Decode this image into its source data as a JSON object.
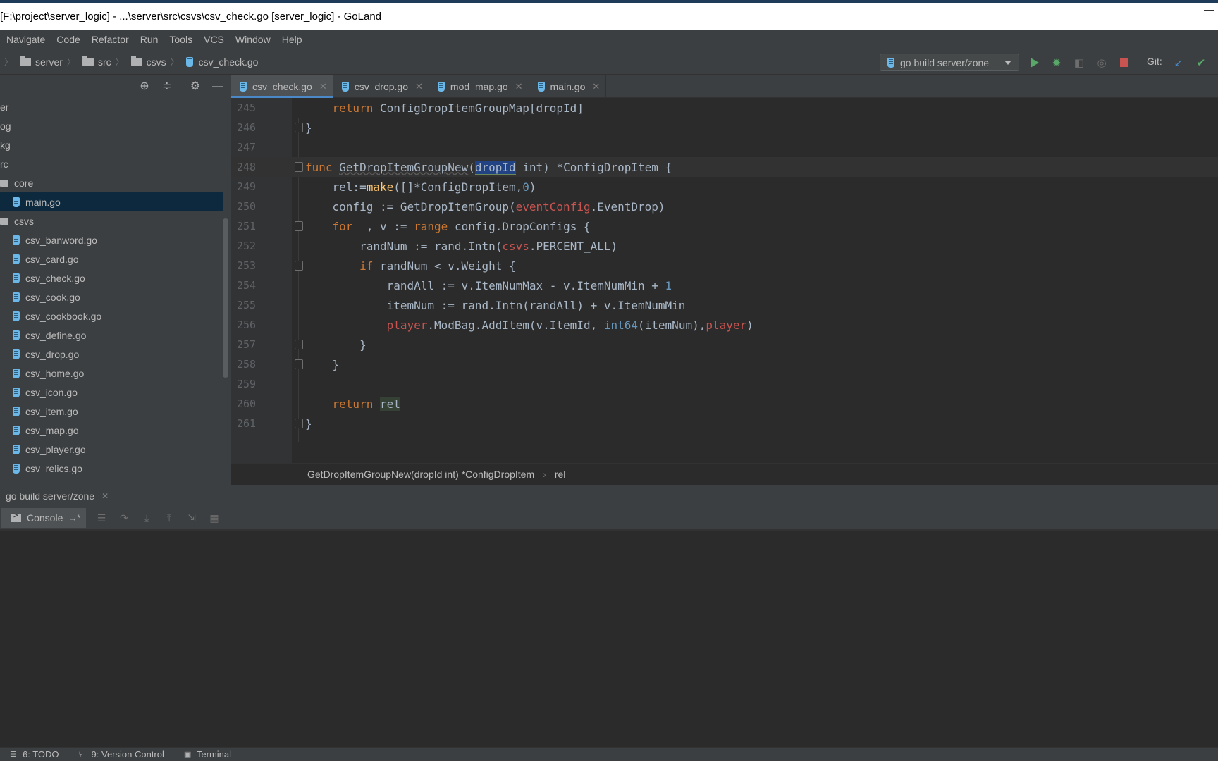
{
  "window": {
    "title": "[F:\\project\\server_logic] - ...\\server\\src\\csvs\\csv_check.go [server_logic] - GoLand"
  },
  "menu": [
    "Navigate",
    "Code",
    "Refactor",
    "Run",
    "Tools",
    "VCS",
    "Window",
    "Help"
  ],
  "breadcrumb": {
    "items": [
      "server",
      "src",
      "csvs"
    ],
    "file": "csv_check.go"
  },
  "toolbar": {
    "run_config": "go build server/zone",
    "git_label": "Git:"
  },
  "colors": {
    "accent": "#4a88c7",
    "run": "#59a869",
    "stop": "#c75450",
    "keyword": "#cc7832",
    "function": "#ffc66d",
    "number": "#6897bb"
  },
  "project_tree": {
    "items": [
      {
        "label": "er",
        "kind": "folder-partial"
      },
      {
        "label": "og",
        "kind": "folder-partial"
      },
      {
        "label": "kg",
        "kind": "folder-partial"
      },
      {
        "label": "rc",
        "kind": "folder-partial"
      },
      {
        "label": "core",
        "kind": "folder"
      },
      {
        "label": "main.go",
        "kind": "file",
        "selected": true
      },
      {
        "label": "csvs",
        "kind": "folder"
      },
      {
        "label": "csv_banword.go",
        "kind": "file"
      },
      {
        "label": "csv_card.go",
        "kind": "file"
      },
      {
        "label": "csv_check.go",
        "kind": "file"
      },
      {
        "label": "csv_cook.go",
        "kind": "file"
      },
      {
        "label": "csv_cookbook.go",
        "kind": "file"
      },
      {
        "label": "csv_define.go",
        "kind": "file"
      },
      {
        "label": "csv_drop.go",
        "kind": "file"
      },
      {
        "label": "csv_home.go",
        "kind": "file"
      },
      {
        "label": "csv_icon.go",
        "kind": "file"
      },
      {
        "label": "csv_item.go",
        "kind": "file"
      },
      {
        "label": "csv_map.go",
        "kind": "file"
      },
      {
        "label": "csv_player.go",
        "kind": "file"
      },
      {
        "label": "csv_relics.go",
        "kind": "file"
      }
    ]
  },
  "editor_tabs": [
    {
      "label": "csv_check.go",
      "active": true
    },
    {
      "label": "csv_drop.go",
      "active": false
    },
    {
      "label": "mod_map.go",
      "active": false
    },
    {
      "label": "main.go",
      "active": false
    }
  ],
  "code": {
    "current_line": "248",
    "lines": [
      {
        "no": "245",
        "text": "    return ConfigDropItemGroupMap[dropId]"
      },
      {
        "no": "246",
        "text": "}"
      },
      {
        "no": "247",
        "text": ""
      },
      {
        "no": "248",
        "text": "func GetDropItemGroupNew(dropId int) *ConfigDropItem {"
      },
      {
        "no": "249",
        "text": "    rel:=make([]*ConfigDropItem,0)"
      },
      {
        "no": "250",
        "text": "    config := GetDropItemGroup(eventConfig.EventDrop)"
      },
      {
        "no": "251",
        "text": "    for _, v := range config.DropConfigs {"
      },
      {
        "no": "252",
        "text": "        randNum := rand.Intn(csvs.PERCENT_ALL)"
      },
      {
        "no": "253",
        "text": "        if randNum < v.Weight {"
      },
      {
        "no": "254",
        "text": "            randAll := v.ItemNumMax - v.ItemNumMin + 1"
      },
      {
        "no": "255",
        "text": "            itemNum := rand.Intn(randAll) + v.ItemNumMin"
      },
      {
        "no": "256",
        "text": "            player.ModBag.AddItem(v.ItemId, int64(itemNum),player)"
      },
      {
        "no": "257",
        "text": "        }"
      },
      {
        "no": "258",
        "text": "    }"
      },
      {
        "no": "259",
        "text": ""
      },
      {
        "no": "260",
        "text": "    return rel"
      },
      {
        "no": "261",
        "text": "}"
      }
    ]
  },
  "editor_breadcrumb": {
    "function": "GetDropItemGroupNew(dropId int) *ConfigDropItem",
    "variable": "rel"
  },
  "run_panel": {
    "tab_label": "go build server/zone",
    "console_label": "Console"
  },
  "statusbar": {
    "todo": "6: TODO",
    "vcs": "9: Version Control",
    "terminal": "Terminal"
  }
}
